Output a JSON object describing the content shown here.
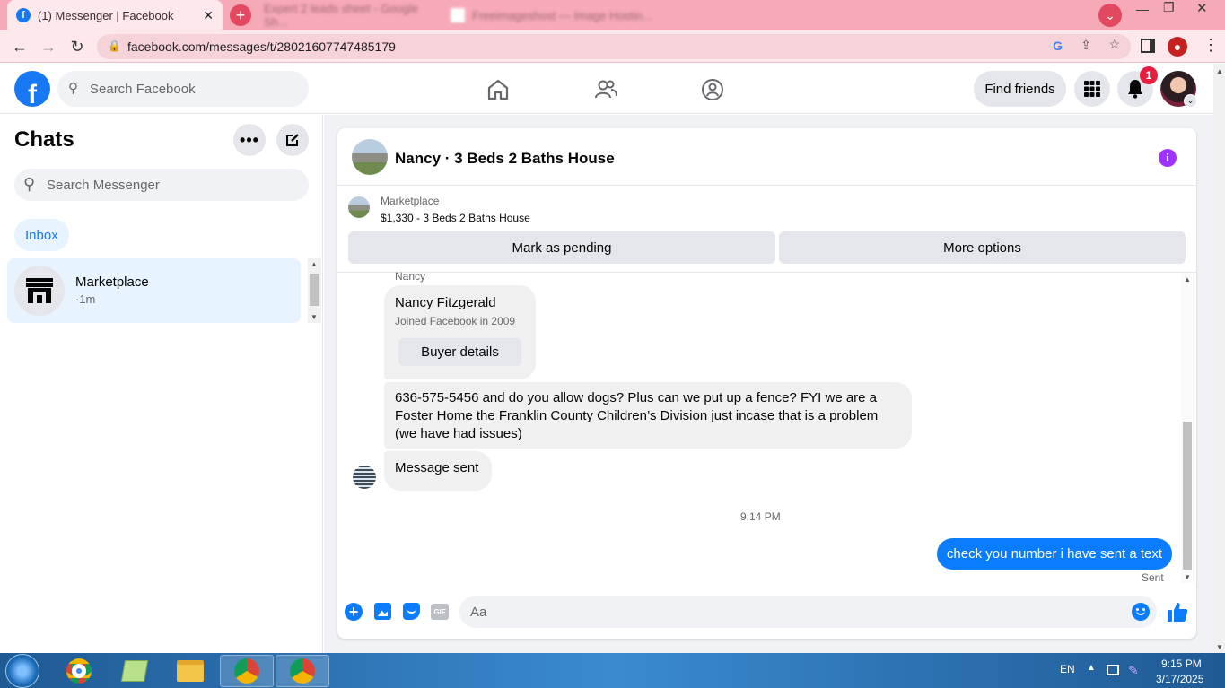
{
  "browser": {
    "tabs": [
      {
        "title": "(1) Messenger | Facebook",
        "active": true
      },
      {
        "title": "Expert 2 leads sheet - Google Sh...",
        "active": false
      },
      {
        "title": "Freeimageshost — Image Hostin...",
        "active": false
      }
    ],
    "url": "facebook.com/messages/t/28021607747485179"
  },
  "fb": {
    "search_placeholder": "Search Facebook",
    "find_friends": "Find friends",
    "notif_count": "1"
  },
  "sidebar": {
    "title": "Chats",
    "search_placeholder": "Search Messenger",
    "inbox_label": "Inbox",
    "chat_name": "Marketplace",
    "chat_time": "·1m"
  },
  "conversation": {
    "title": "Nancy · 3 Beds 2 Baths House",
    "listing_source": "Marketplace",
    "listing": "$1,330 - 3 Beds 2 Baths House",
    "mark_pending": "Mark as pending",
    "more_options": "More options",
    "sender_label": "Nancy",
    "profile_name": "Nancy Fitzgerald",
    "profile_joined": "Joined Facebook in 2009",
    "buyer_details": "Buyer details",
    "message1": "636-575-5456 and do you allow dogs? Plus can we put up a fence? FYI we are a Foster Home the Franklin County Children’s Division just incase that is a problem (we have had issues)",
    "message2": "Message sent",
    "timestamp": "9:14 PM",
    "my_message": "check you number i have sent a text",
    "status": "Sent",
    "composer_placeholder": "Aa"
  },
  "taskbar": {
    "lang": "EN",
    "time": "9:15 PM",
    "date": "3/17/2025"
  },
  "colors": {
    "fb_blue": "#1877f2",
    "chrome_pink": "#f6a9b7",
    "info_purple": "#a033ff",
    "notif_red": "#e41e3f"
  }
}
